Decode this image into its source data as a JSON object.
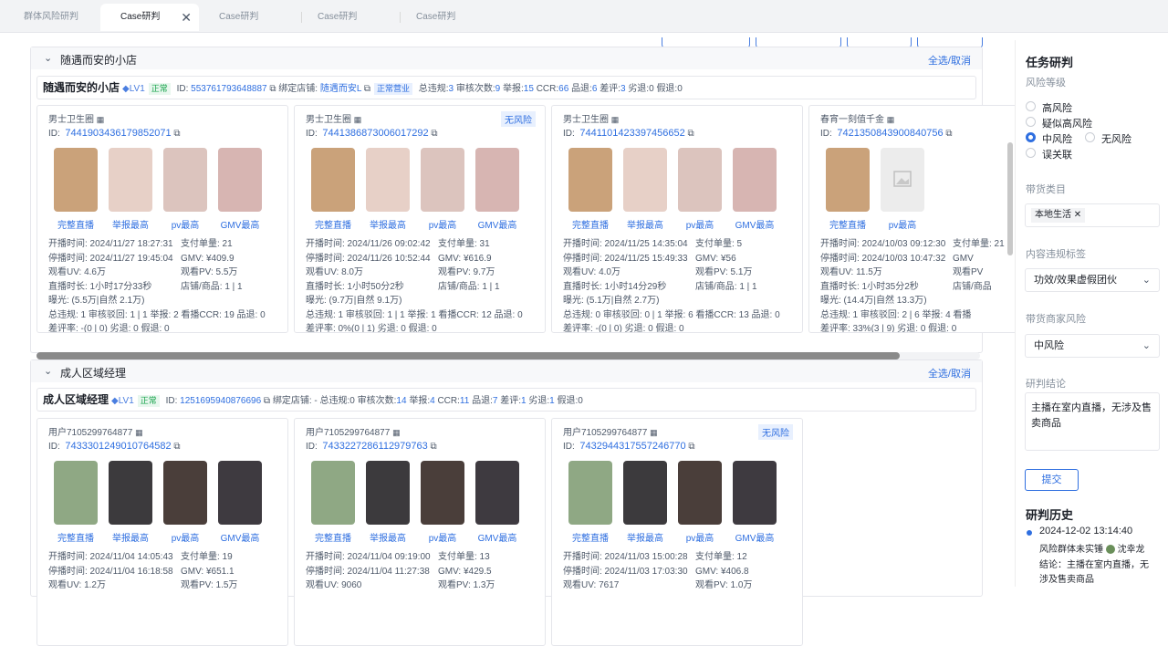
{
  "tabs": [
    {
      "label": "群体风险研判",
      "active": false
    },
    {
      "label": "Case研判",
      "active": true
    },
    {
      "label": "Case研判",
      "active": false
    },
    {
      "label": "Case研判",
      "active": false
    },
    {
      "label": "Case研判",
      "active": false
    }
  ],
  "select_all_label": "全选/取消",
  "thumb_labels": {
    "live": "完整直播",
    "report": "举报最高",
    "pv": "pv最高",
    "gmv": "GMV最高"
  },
  "groups": [
    {
      "name": "随遇而安的小店",
      "shop": {
        "name": "随遇而安的小店",
        "level": "LV1",
        "status": "正常",
        "id_label": "ID:",
        "id": "553761793648887",
        "bind_label": "绑定店铺:",
        "bind_value": "随遇而安L",
        "bind_status": "正常营业",
        "stats": [
          {
            "label": "总违规:",
            "value": "3"
          },
          {
            "label": "审核次数:",
            "value": "9"
          },
          {
            "label": "举报:",
            "value": "15"
          },
          {
            "label": "CCR:",
            "value": "66"
          },
          {
            "label": "品退:",
            "value": "6"
          },
          {
            "label": "差评:",
            "value": "3"
          },
          {
            "label": "劣退:",
            "value": "0"
          },
          {
            "label": "假退:",
            "value": "0"
          }
        ]
      },
      "cards": [
        {
          "user": "男士卫生圈",
          "badge": "",
          "id": "7441903436179852071",
          "thumbs": [
            "live",
            "report",
            "pv",
            "gmv"
          ],
          "rows": [
            [
              "开播时间: 2024/11/27 18:27:31",
              "支付单量: 21"
            ],
            [
              "停播时间: 2024/11/27 19:45:04",
              "GMV: ¥409.9"
            ],
            [
              "观看UV: 4.6万",
              "观看PV: 5.5万"
            ],
            [
              "直播时长: 1小时17分33秒",
              "店铺/商品: 1 | 1"
            ],
            [
              "曝光: (5.5万|自然 2.1万)",
              ""
            ],
            [
              "总违规: 1  审核驳回: 1 | 1  举报: 2  看播CCR: 19  品退: 0",
              ""
            ],
            [
              "差评率: -(0 | 0)  劣退: 0  假退: 0",
              ""
            ]
          ]
        },
        {
          "user": "男士卫生圈",
          "badge": "无风险",
          "id": "7441386873006017292",
          "thumbs": [
            "live",
            "report",
            "pv",
            "gmv"
          ],
          "rows": [
            [
              "开播时间: 2024/11/26 09:02:42",
              "支付单量: 31"
            ],
            [
              "停播时间: 2024/11/26 10:52:44",
              "GMV: ¥616.9"
            ],
            [
              "观看UV: 8.0万",
              "观看PV: 9.7万"
            ],
            [
              "直播时长: 1小时50分2秒",
              "店铺/商品: 1 | 1"
            ],
            [
              "曝光: (9.7万|自然 9.1万)",
              ""
            ],
            [
              "总违规: 1  审核驳回: 1 | 1  举报: 1  看播CCR: 12  品退: 0",
              ""
            ],
            [
              "差评率: 0%(0 | 1)  劣退: 0  假退: 0",
              ""
            ]
          ]
        },
        {
          "user": "男士卫生圈",
          "badge": "",
          "id": "7441101423397456652",
          "thumbs": [
            "live",
            "report",
            "pv",
            "gmv"
          ],
          "rows": [
            [
              "开播时间: 2024/11/25 14:35:04",
              "支付单量: 5"
            ],
            [
              "停播时间: 2024/11/25 15:49:33",
              "GMV: ¥56"
            ],
            [
              "观看UV: 4.0万",
              "观看PV: 5.1万"
            ],
            [
              "直播时长: 1小时14分29秒",
              "店铺/商品: 1 | 1"
            ],
            [
              "曝光: (5.1万|自然 2.7万)",
              ""
            ],
            [
              "总违规: 0  审核驳回: 0 | 1  举报: 6  看播CCR: 13  品退: 0",
              ""
            ],
            [
              "差评率: -(0 | 0)  劣退: 0  假退: 0",
              ""
            ]
          ]
        },
        {
          "user": "春宵一刻值千金",
          "badge": "",
          "id": "7421350843900840756",
          "thumbs": [
            "live",
            "pv"
          ],
          "rows": [
            [
              "开播时间: 2024/10/03 09:12:30",
              "支付单量: 21"
            ],
            [
              "停播时间: 2024/10/03 10:47:32",
              "GMV"
            ],
            [
              "观看UV: 11.5万",
              "观看PV"
            ],
            [
              "直播时长: 1小时35分2秒",
              "店铺/商品"
            ],
            [
              "曝光: (14.4万|自然 13.3万)",
              ""
            ],
            [
              "总违规: 1  审核驳回: 2 | 6  举报: 4  看播",
              ""
            ],
            [
              "差评率: 33%(3 | 9)  劣退: 0  假退: 0",
              ""
            ]
          ]
        }
      ]
    },
    {
      "name": "成人区域经理",
      "shop": {
        "name": "成人区域经理",
        "level": "LV1",
        "status": "正常",
        "id_label": "ID:",
        "id": "1251695940876696",
        "bind_label": "绑定店铺:",
        "bind_value": "-",
        "bind_status": "",
        "stats": [
          {
            "label": "总违规:",
            "value": "0"
          },
          {
            "label": "审核次数:",
            "value": "14"
          },
          {
            "label": "举报:",
            "value": "4"
          },
          {
            "label": "CCR:",
            "value": "11"
          },
          {
            "label": "品退:",
            "value": "7"
          },
          {
            "label": "差评:",
            "value": "1"
          },
          {
            "label": "劣退:",
            "value": "1"
          },
          {
            "label": "假退:",
            "value": "0"
          }
        ]
      },
      "cards": [
        {
          "user": "用户7105299764877",
          "badge": "",
          "id": "7433301249010764582",
          "thumbs": [
            "live",
            "report",
            "pv",
            "gmv"
          ],
          "rows": [
            [
              "开播时间: 2024/11/04 14:05:43",
              "支付单量: 19"
            ],
            [
              "停播时间: 2024/11/04 16:18:58",
              "GMV: ¥651.1"
            ],
            [
              "观看UV: 1.2万",
              "观看PV: 1.5万"
            ]
          ]
        },
        {
          "user": "用户7105299764877",
          "badge": "",
          "id": "7433227286112979763",
          "thumbs": [
            "live",
            "report",
            "pv",
            "gmv"
          ],
          "rows": [
            [
              "开播时间: 2024/11/04 09:19:00",
              "支付单量: 13"
            ],
            [
              "停播时间: 2024/11/04 11:27:38",
              "GMV: ¥429.5"
            ],
            [
              "观看UV: 9060",
              "观看PV: 1.3万"
            ]
          ]
        },
        {
          "user": "用户7105299764877",
          "badge": "无风险",
          "id": "7432944317557246770",
          "thumbs": [
            "live",
            "report",
            "pv",
            "gmv"
          ],
          "rows": [
            [
              "开播时间: 2024/11/03 15:00:28",
              "支付单量: 12"
            ],
            [
              "停播时间: 2024/11/03 17:03:30",
              "GMV: ¥406.8"
            ],
            [
              "观看UV: 7617",
              "观看PV: 1.0万"
            ]
          ]
        }
      ]
    }
  ],
  "sidebar": {
    "title": "任务研判",
    "risk_label": "风险等级",
    "risk_options": [
      "高风险",
      "疑似高风险",
      "中风险",
      "无风险",
      "误关联"
    ],
    "risk_selected": "中风险",
    "category_label": "带货类目",
    "category_chip": "本地生活",
    "violation_label": "内容违规标签",
    "violation_value": "功效/效果虚假团伙",
    "merchant_label": "带货商家风险",
    "merchant_value": "中风险",
    "conclusion_label": "研判结论",
    "conclusion_text": "主播在室内直播，无涉及售卖商品",
    "submit": "提交",
    "history_title": "研判历史",
    "history_time": "2024-12-02 13:14:40",
    "history_group": "风险群体未实锤",
    "history_user": "沈幸龙",
    "history_conclusion_1": "结论：主播在室内直播，无",
    "history_conclusion_2": "涉及售卖商品"
  }
}
